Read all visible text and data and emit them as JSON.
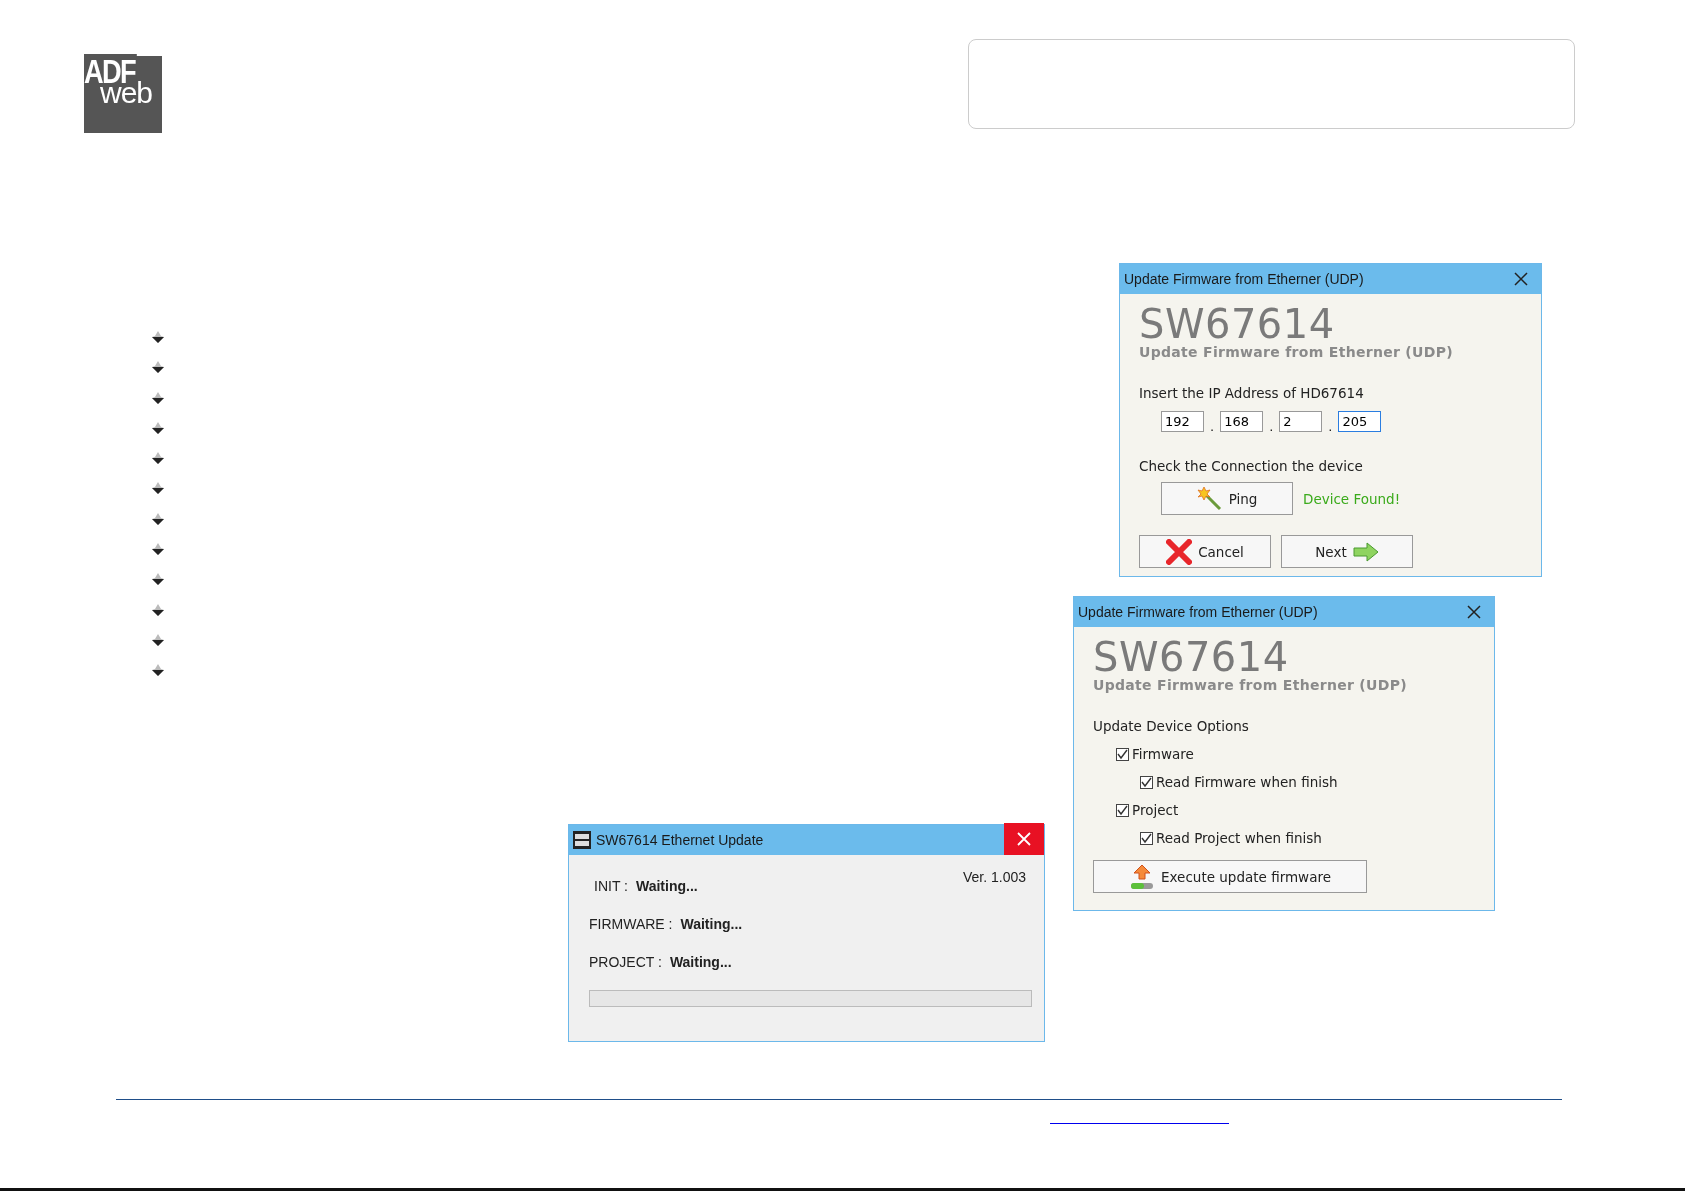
{
  "logo": {
    "top": "ADF",
    "bottom": "web"
  },
  "bullets": [
    {
      "kind": "arrow"
    },
    {
      "kind": "arrow"
    },
    {
      "kind": "arrow"
    },
    {
      "kind": "arrow"
    },
    {
      "kind": "arrow"
    },
    {
      "kind": "arrow"
    },
    {
      "kind": "arrow"
    },
    {
      "kind": "arrow"
    },
    {
      "kind": "arrow"
    },
    {
      "kind": "arrow"
    },
    {
      "kind": "arrow"
    },
    {
      "kind": "arrow"
    }
  ],
  "ip_dialog": {
    "title": "Update Firmware from Etherner (UDP)",
    "heading": "SW67614",
    "subheading": "Update Firmware from Etherner (UDP)",
    "ip_label": "Insert the IP Address of HD67614",
    "ip_fields": [
      {
        "value": "192",
        "focused": false
      },
      {
        "value": "168",
        "focused": false
      },
      {
        "value": "2",
        "focused": false
      },
      {
        "value": "205",
        "focused": true
      }
    ],
    "separator": ".",
    "check_label": "Check the Connection the device",
    "ping_button": "Ping",
    "ping_status": "Device Found!",
    "cancel_button": "Cancel",
    "next_button": "Next"
  },
  "options_dialog": {
    "title": "Update Firmware from Etherner (UDP)",
    "heading": "SW67614",
    "subheading": "Update Firmware from Etherner (UDP)",
    "section_label": "Update Device Options",
    "options": [
      {
        "label": "Firmware",
        "checked": true,
        "children": [
          {
            "label": "Read Firmware when finish",
            "checked": true
          }
        ]
      },
      {
        "label": "Project",
        "checked": true,
        "children": [
          {
            "label": "Read Project when finish",
            "checked": true
          }
        ]
      }
    ],
    "execute_button": "Execute update firmware"
  },
  "update_window": {
    "title": "SW67614 Ethernet Update",
    "version": "Ver. 1.003",
    "rows": [
      {
        "label": "INIT :",
        "value": "Waiting..."
      },
      {
        "label": "FIRMWARE :",
        "value": "Waiting..."
      },
      {
        "label": "PROJECT :",
        "value": "Waiting..."
      }
    ],
    "progress": {
      "level": 0
    }
  }
}
